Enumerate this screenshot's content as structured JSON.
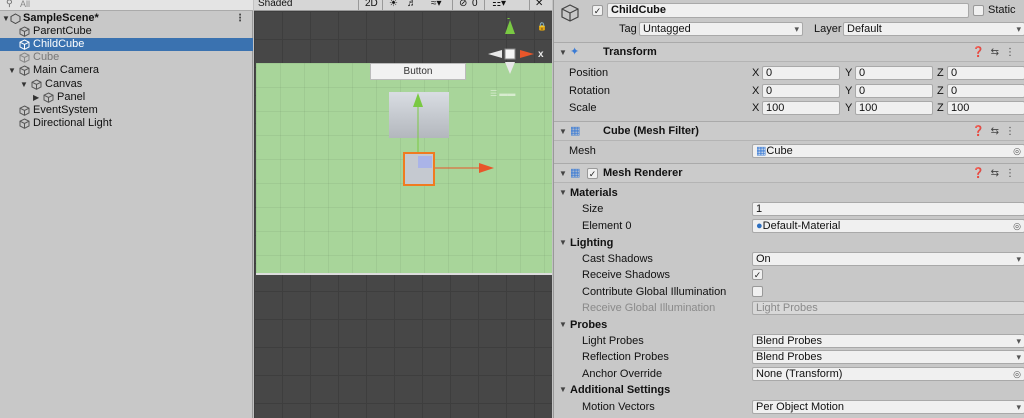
{
  "hierarchy": {
    "search": {
      "placeholder": "All"
    },
    "scene": {
      "name": "SampleScene*",
      "menu": "⋮"
    },
    "items": [
      {
        "label": "ParentCube"
      },
      {
        "label": "ChildCube"
      },
      {
        "label": "Cube"
      },
      {
        "label": "Main Camera"
      },
      {
        "label": "Canvas"
      },
      {
        "label": "Panel"
      },
      {
        "label": "EventSystem"
      },
      {
        "label": "Directional Light"
      }
    ]
  },
  "scene_view": {
    "toolbar": {
      "shading": "Shaded",
      "mode_2d": "2D",
      "hidden_count": "0"
    },
    "button_label": "Button",
    "gizmo": {
      "y": "y",
      "x": "x"
    },
    "colors": {
      "canvas": "#a8d59a",
      "selection": "#f07b20",
      "y_axis": "#7ac943",
      "x_axis": "#e8562a"
    }
  },
  "inspector": {
    "object": {
      "name": "ChildCube",
      "static_label": "Static",
      "tag_label": "Tag",
      "tag_value": "Untagged",
      "layer_label": "Layer",
      "layer_value": "Default"
    },
    "transform": {
      "title": "Transform",
      "rows": [
        {
          "label": "Position",
          "x": "0",
          "y": "0",
          "z": "0"
        },
        {
          "label": "Rotation",
          "x": "0",
          "y": "0",
          "z": "0"
        },
        {
          "label": "Scale",
          "x": "100",
          "y": "100",
          "z": "100"
        }
      ]
    },
    "mesh_filter": {
      "title": "Cube (Mesh Filter)",
      "mesh_label": "Mesh",
      "mesh_value": "Cube"
    },
    "mesh_renderer": {
      "title": "Mesh Renderer",
      "materials_header": "Materials",
      "size_label": "Size",
      "size_value": "1",
      "element0_label": "Element 0",
      "element0_value": "Default-Material",
      "lighting_header": "Lighting",
      "cast_shadows_label": "Cast Shadows",
      "cast_shadows_value": "On",
      "receive_shadows_label": "Receive Shadows",
      "contribute_gi_label": "Contribute Global Illumination",
      "receive_gi_label": "Receive Global Illumination",
      "receive_gi_value": "Light Probes",
      "probes_header": "Probes",
      "light_probes_label": "Light Probes",
      "light_probes_value": "Blend Probes",
      "reflection_probes_label": "Reflection Probes",
      "reflection_probes_value": "Blend Probes",
      "anchor_label": "Anchor Override",
      "anchor_value": "None (Transform)",
      "additional_header": "Additional Settings",
      "motion_vectors_label": "Motion Vectors",
      "motion_vectors_value": "Per Object Motion"
    },
    "axis_labels": {
      "x": "X",
      "y": "Y",
      "z": "Z"
    }
  }
}
